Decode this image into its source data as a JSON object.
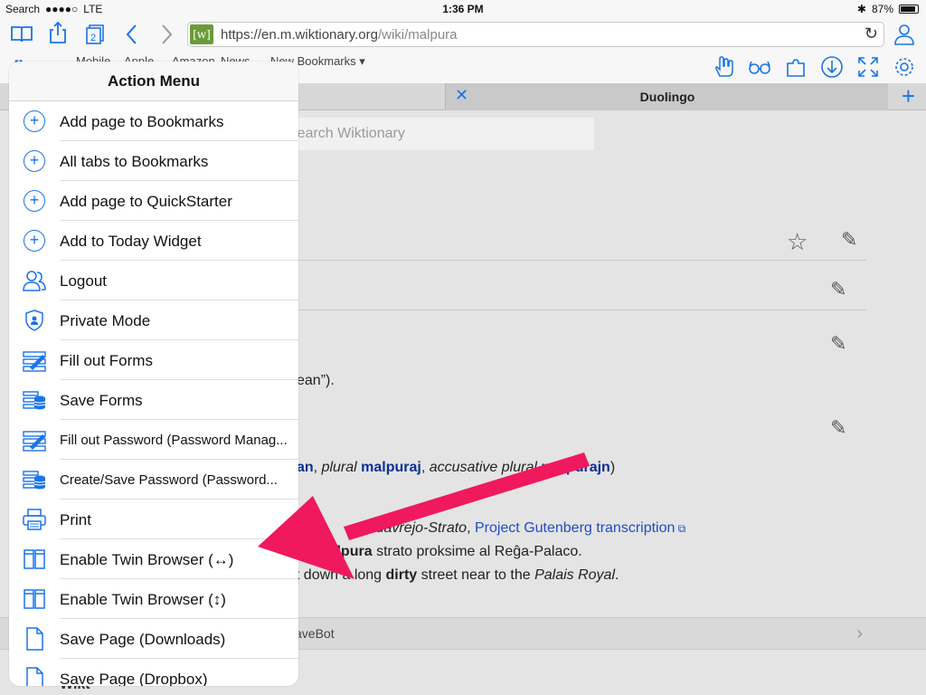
{
  "status_bar": {
    "carrier_back": "Search",
    "signal": "●●●●○",
    "network": "LTE",
    "time": "1:36 PM",
    "bluetooth": "✱",
    "battery": "87%"
  },
  "toolbar": {
    "url_host": "https://en.m.wiktionary.org",
    "url_path": "/wiki/malpura",
    "favicon": "[w]",
    "bookmarks": [
      "Mobile",
      "Apple",
      "Amazon",
      "News",
      "New Bookmarks ▾"
    ]
  },
  "tabs": {
    "active_title": "Duolingo"
  },
  "web": {
    "search_placeholder": "Search Wiktionary",
    "line_ean": "ean”).",
    "plural_prefix": "an",
    "plural_label": "plural",
    "plural_word": "malpuraj",
    "accusative_label": "accusative plural",
    "accusative_word": "malpurajn",
    "citation_prefix": "Kadavrejo-Strato",
    "citation_link": "Project Gutenberg transcription",
    "example_eo_pre": "a",
    "example_eo_bold": "malpura",
    "example_eo_post": "strato proksime al Reĝa-Palaco.",
    "example_en_pre": "nt down a long",
    "example_en_bold": "dirty",
    "example_en_mid": "street near to the",
    "example_en_italic": "Palais Royal",
    "example_en_end": ".",
    "footer_text": "aveBot",
    "bottom_text": "Wikt"
  },
  "action_menu": {
    "title": "Action Menu",
    "items": [
      {
        "label": "Add page to Bookmarks",
        "icon": "plus-circle-icon"
      },
      {
        "label": "All tabs to Bookmarks",
        "icon": "plus-circle-icon"
      },
      {
        "label": "Add page to QuickStarter",
        "icon": "plus-circle-icon"
      },
      {
        "label": "Add to Today Widget",
        "icon": "plus-circle-icon"
      },
      {
        "label": "Logout",
        "icon": "users-icon"
      },
      {
        "label": "Private Mode",
        "icon": "shield-icon"
      },
      {
        "label": "Fill out Forms",
        "icon": "form-pen-icon"
      },
      {
        "label": "Save Forms",
        "icon": "database-icon"
      },
      {
        "label": "Fill out Password (Password Manag...",
        "icon": "form-pen-icon"
      },
      {
        "label": "Create/Save Password (Password...",
        "icon": "database-icon"
      },
      {
        "label": "Print",
        "icon": "printer-icon"
      },
      {
        "label": "Enable Twin Browser (↔)",
        "icon": "twin-browser-icon"
      },
      {
        "label": "Enable Twin Browser (↕)",
        "icon": "twin-browser-icon"
      },
      {
        "label": "Save Page (Downloads)",
        "icon": "document-icon"
      },
      {
        "label": "Save Page (Dropbox)",
        "icon": "document-icon"
      }
    ]
  },
  "colors": {
    "accent": "#1a73e8",
    "arrow": "#f0195d"
  }
}
